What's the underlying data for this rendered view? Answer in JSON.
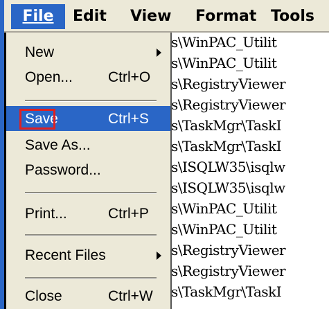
{
  "menubar": {
    "items": [
      {
        "label": "File"
      },
      {
        "label": "Edit"
      },
      {
        "label": "View"
      },
      {
        "label": "Format"
      },
      {
        "label": "Tools"
      }
    ]
  },
  "file_menu": {
    "items": [
      {
        "label": "New",
        "shortcut": "",
        "has_submenu": true
      },
      {
        "label": "Open...",
        "shortcut": "Ctrl+O"
      },
      {
        "label": "Save",
        "shortcut": "Ctrl+S",
        "selected": true,
        "highlighted_by_red_box": true
      },
      {
        "label": "Save As...",
        "shortcut": ""
      },
      {
        "label": "Password...",
        "shortcut": ""
      },
      {
        "label": "Print...",
        "shortcut": "Ctrl+P"
      },
      {
        "label": "Recent Files",
        "shortcut": "",
        "has_submenu": true
      },
      {
        "label": "Close",
        "shortcut": "Ctrl+W"
      }
    ]
  },
  "document": {
    "lines": [
      "s\\WinPAC_Utilit",
      "s\\WinPAC_Utilit",
      "s\\RegistryViewer",
      "s\\RegistryViewer",
      "s\\TaskMgr\\TaskI",
      "s\\TaskMgr\\TaskI",
      "s\\ISQLW35\\isqlw",
      "s\\ISQLW35\\isqlw",
      "s\\WinPAC_Utilit",
      "s\\WinPAC_Utilit",
      "s\\RegistryViewer",
      "s\\RegistryViewer",
      "s\\TaskMgr\\TaskI"
    ]
  },
  "colors": {
    "selection": "#2a66c6",
    "menu_bg": "#ece9d8",
    "highlight_box": "#e02020"
  }
}
